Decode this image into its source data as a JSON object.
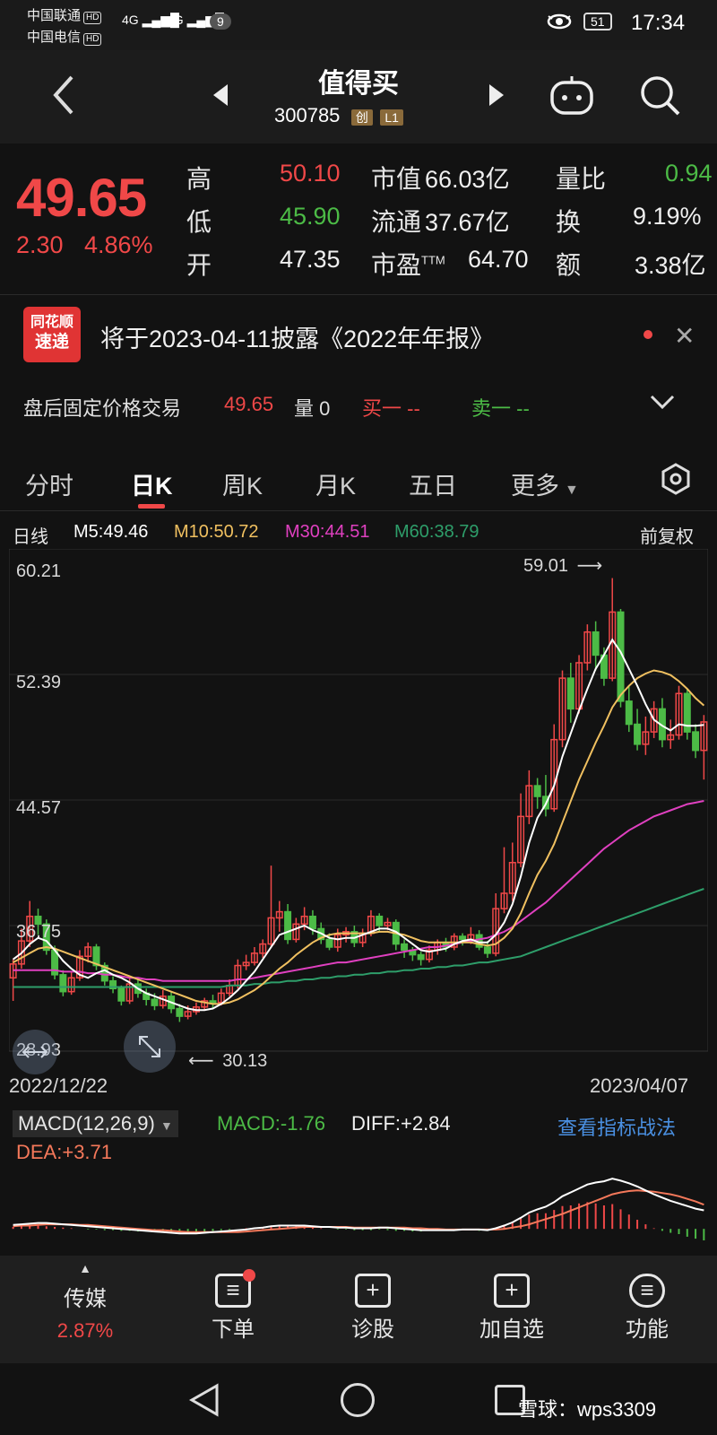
{
  "status_bar": {
    "carrier1": "中国联通",
    "carrier2": "中国电信",
    "hd": "HD",
    "network": "4G",
    "notif_count": "9",
    "battery": "51",
    "time": "17:34"
  },
  "header": {
    "title": "值得买",
    "code": "300785",
    "tag1": "创",
    "tag2": "L1"
  },
  "quote": {
    "price": "49.65",
    "change": "2.30",
    "change_pct": "4.86%",
    "high_label": "高",
    "high": "50.10",
    "low_label": "低",
    "low": "45.90",
    "open_label": "开",
    "open": "47.35",
    "mcap_label": "市值",
    "mcap": "66.03亿",
    "float_label": "流通",
    "float": "37.67亿",
    "pe_label": "市盈",
    "pe_sup": "TTM",
    "pe": "64.70",
    "vr_label": "量比",
    "vr": "0.94",
    "turnover_label": "换",
    "turnover": "9.19%",
    "amount_label": "额",
    "amount": "3.38亿"
  },
  "notice": {
    "logo_line1": "同花顺",
    "logo_line2": "速递",
    "text": "将于2023-04-11披露《2022年年报》"
  },
  "after_hours": {
    "label": "盘后固定价格交易",
    "price": "49.65",
    "vol_label": "量",
    "vol": "0",
    "buy": "买一 --",
    "sell": "卖一 --"
  },
  "tabs": [
    "分时",
    "日K",
    "周K",
    "月K",
    "五日",
    "更多"
  ],
  "kline": {
    "label": "日线",
    "ma5": "M5:49.46",
    "ma10": "M10:50.72",
    "ma30": "M30:44.51",
    "ma60": "M60:38.79",
    "adjust": "前复权",
    "y_ticks": [
      "60.21",
      "52.39",
      "44.57",
      "36.75",
      "28.93"
    ],
    "high_mark": "59.01",
    "low_mark": "30.13",
    "date_start": "2022/12/22",
    "date_end": "2023/04/07"
  },
  "macd": {
    "selector": "MACD(12,26,9)",
    "macd": "MACD:-1.76",
    "diff": "DIFF:+2.84",
    "dea": "DEA:+3.71",
    "link": "查看指标战法"
  },
  "bottom_nav": {
    "sector_name": "传媒",
    "sector_pct": "2.87%",
    "order": "下单",
    "diagnose": "诊股",
    "add_fav": "加自选",
    "functions": "功能"
  },
  "watermark": "雪球：wps3309",
  "colors": {
    "up": "#f04848",
    "down": "#4cbb46",
    "ma5": "#ffffff",
    "ma10": "#f0c060",
    "ma30": "#e040c0",
    "ma60": "#2e9e6a"
  },
  "chart_data": {
    "type": "candlestick",
    "x_range": [
      "2022/12/22",
      "2023/04/07"
    ],
    "ylim": [
      28.93,
      60.21
    ],
    "candles": [
      [
        33.0,
        33.9,
        31.5,
        34.2
      ],
      [
        33.9,
        35.4,
        33.6,
        36.2
      ],
      [
        35.4,
        37.0,
        35.0,
        38.0
      ],
      [
        37.0,
        36.5,
        35.8,
        37.5
      ],
      [
        36.5,
        34.8,
        34.5,
        36.8
      ],
      [
        34.8,
        33.2,
        32.9,
        35.1
      ],
      [
        33.2,
        32.1,
        31.8,
        33.5
      ],
      [
        32.1,
        33.0,
        31.9,
        33.4
      ],
      [
        33.0,
        34.4,
        32.8,
        34.8
      ],
      [
        34.4,
        35.0,
        34.0,
        35.3
      ],
      [
        35.0,
        33.8,
        33.5,
        35.2
      ],
      [
        33.8,
        32.8,
        32.5,
        34.0
      ],
      [
        32.8,
        32.3,
        32.0,
        33.1
      ],
      [
        32.3,
        31.5,
        31.2,
        32.5
      ],
      [
        31.5,
        32.6,
        31.3,
        33.0
      ],
      [
        32.6,
        32.0,
        31.7,
        32.9
      ],
      [
        32.0,
        31.6,
        31.2,
        32.3
      ],
      [
        31.6,
        31.2,
        30.9,
        32.0
      ],
      [
        31.2,
        31.8,
        31.0,
        32.2
      ],
      [
        31.8,
        31.0,
        30.7,
        32.1
      ],
      [
        31.0,
        30.5,
        30.13,
        31.3
      ],
      [
        30.5,
        30.8,
        30.3,
        31.2
      ],
      [
        30.8,
        31.1,
        30.6,
        31.4
      ],
      [
        31.1,
        31.5,
        30.9,
        31.7
      ],
      [
        31.5,
        31.4,
        31.0,
        31.9
      ],
      [
        31.4,
        32.0,
        31.2,
        32.3
      ],
      [
        32.0,
        32.5,
        31.8,
        32.9
      ],
      [
        32.5,
        33.8,
        32.3,
        34.2
      ],
      [
        33.8,
        34.0,
        33.5,
        34.5
      ],
      [
        34.0,
        34.6,
        33.8,
        35.0
      ],
      [
        34.6,
        35.2,
        34.3,
        35.5
      ],
      [
        35.2,
        36.9,
        35.0,
        40.3
      ],
      [
        36.9,
        37.3,
        36.0,
        38.0
      ],
      [
        37.3,
        35.5,
        35.2,
        37.8
      ],
      [
        35.5,
        36.5,
        35.3,
        36.9
      ],
      [
        36.5,
        37.0,
        36.1,
        37.6
      ],
      [
        37.0,
        36.2,
        35.8,
        37.4
      ],
      [
        36.2,
        35.5,
        35.2,
        36.6
      ],
      [
        35.5,
        35.0,
        34.8,
        35.9
      ],
      [
        35.0,
        35.8,
        34.7,
        36.2
      ],
      [
        35.8,
        36.0,
        35.3,
        36.3
      ],
      [
        36.0,
        35.3,
        35.0,
        36.4
      ],
      [
        35.3,
        35.9,
        35.0,
        36.2
      ],
      [
        35.9,
        37.0,
        35.7,
        37.4
      ],
      [
        37.0,
        36.4,
        36.0,
        37.2
      ],
      [
        36.4,
        36.6,
        36.1,
        36.9
      ],
      [
        36.6,
        35.2,
        34.8,
        36.8
      ],
      [
        35.2,
        34.8,
        34.3,
        35.5
      ],
      [
        34.8,
        34.5,
        34.1,
        35.0
      ],
      [
        34.5,
        34.2,
        33.8,
        34.7
      ],
      [
        34.2,
        34.8,
        34.0,
        35.1
      ],
      [
        34.8,
        35.3,
        34.5,
        35.5
      ],
      [
        35.3,
        35.0,
        34.7,
        35.6
      ],
      [
        35.0,
        35.7,
        34.8,
        35.9
      ],
      [
        35.7,
        35.5,
        35.1,
        35.9
      ],
      [
        35.5,
        35.8,
        35.2,
        36.3
      ],
      [
        35.8,
        35.0,
        34.8,
        36.1
      ],
      [
        35.0,
        34.6,
        34.3,
        35.4
      ],
      [
        34.6,
        37.5,
        34.4,
        38.5
      ],
      [
        37.5,
        38.5,
        37.2,
        41.5
      ],
      [
        38.5,
        40.5,
        38.0,
        41.8
      ],
      [
        40.5,
        43.5,
        40.2,
        45.0
      ],
      [
        43.5,
        45.5,
        43.0,
        46.5
      ],
      [
        45.5,
        44.8,
        44.0,
        46.0
      ],
      [
        44.8,
        44.0,
        43.5,
        46.2
      ],
      [
        44.0,
        48.5,
        43.8,
        49.5
      ],
      [
        48.5,
        52.5,
        48.0,
        53.0
      ],
      [
        52.5,
        50.5,
        49.6,
        53.5
      ],
      [
        50.5,
        53.5,
        50.2,
        54.0
      ],
      [
        53.5,
        55.5,
        53.0,
        56.0
      ],
      [
        55.5,
        54.0,
        53.0,
        56.2
      ],
      [
        54.0,
        52.5,
        52.0,
        54.5
      ],
      [
        52.5,
        56.8,
        52.3,
        59.01
      ],
      [
        56.8,
        51.0,
        50.6,
        57.0
      ],
      [
        51.0,
        49.5,
        49.0,
        52.0
      ],
      [
        49.5,
        48.2,
        47.8,
        50.5
      ],
      [
        48.2,
        49.0,
        47.5,
        50.0
      ],
      [
        49.0,
        50.5,
        48.6,
        51.0
      ],
      [
        50.5,
        48.5,
        48.0,
        51.2
      ],
      [
        48.5,
        48.8,
        47.9,
        49.8
      ],
      [
        48.8,
        51.5,
        48.5,
        52.0
      ],
      [
        51.5,
        49.0,
        48.5,
        51.8
      ],
      [
        49.0,
        47.8,
        47.3,
        49.5
      ],
      [
        47.8,
        49.65,
        45.9,
        50.1
      ]
    ],
    "ma5": [
      34.2,
      34.6,
      35.2,
      35.6,
      35.4,
      34.8,
      34.1,
      33.6,
      33.2,
      33.0,
      33.3,
      33.5,
      33.2,
      33.0,
      32.7,
      32.3,
      32.0,
      31.8,
      31.6,
      31.4,
      31.2,
      31.0,
      30.9,
      30.9,
      31.0,
      31.3,
      31.7,
      32.2,
      32.8,
      33.4,
      34.2,
      35.0,
      35.8,
      36.0,
      36.2,
      36.4,
      36.1,
      35.9,
      35.6,
      35.5,
      35.6,
      35.6,
      35.8,
      36.0,
      36.2,
      36.2,
      36.0,
      35.6,
      35.2,
      34.8,
      34.7,
      34.8,
      34.9,
      35.2,
      35.4,
      35.5,
      35.3,
      35.3,
      35.8,
      36.6,
      37.8,
      39.6,
      41.8,
      43.4,
      44.3,
      45.5,
      47.4,
      48.9,
      50.4,
      51.8,
      53.1,
      54.0,
      55.0,
      54.2,
      53.1,
      52.0,
      50.8,
      49.8,
      49.4,
      49.1,
      49.5,
      49.4,
      49.4,
      49.46
    ],
    "ma10": [
      34.0,
      34.3,
      34.6,
      34.9,
      35.0,
      34.9,
      34.7,
      34.5,
      34.3,
      34.1,
      33.9,
      33.7,
      33.5,
      33.3,
      33.1,
      32.9,
      32.7,
      32.5,
      32.3,
      32.1,
      31.9,
      31.7,
      31.5,
      31.4,
      31.3,
      31.3,
      31.4,
      31.6,
      31.9,
      32.2,
      32.6,
      33.1,
      33.6,
      34.0,
      34.5,
      34.9,
      35.3,
      35.6,
      35.8,
      35.9,
      35.9,
      35.9,
      35.9,
      35.9,
      36.0,
      36.0,
      35.9,
      35.8,
      35.6,
      35.4,
      35.3,
      35.3,
      35.3,
      35.3,
      35.3,
      35.3,
      35.2,
      35.1,
      35.2,
      35.6,
      36.2,
      37.2,
      38.5,
      39.7,
      40.6,
      41.7,
      43.1,
      44.5,
      45.9,
      47.1,
      48.3,
      49.4,
      50.6,
      51.4,
      52.0,
      52.5,
      52.8,
      53.0,
      52.9,
      52.7,
      52.3,
      51.8,
      51.2,
      50.72
    ],
    "ma30": [
      33.5,
      33.5,
      33.5,
      33.5,
      33.5,
      33.5,
      33.4,
      33.4,
      33.4,
      33.3,
      33.3,
      33.2,
      33.2,
      33.1,
      33.0,
      33.0,
      32.9,
      32.9,
      32.8,
      32.8,
      32.8,
      32.8,
      32.8,
      32.8,
      32.8,
      32.8,
      32.8,
      32.9,
      32.9,
      33.0,
      33.1,
      33.2,
      33.3,
      33.4,
      33.5,
      33.6,
      33.7,
      33.8,
      33.9,
      34.0,
      34.0,
      34.1,
      34.2,
      34.3,
      34.4,
      34.5,
      34.6,
      34.7,
      34.8,
      34.9,
      35.0,
      35.0,
      35.1,
      35.2,
      35.3,
      35.4,
      35.5,
      35.6,
      35.8,
      36.0,
      36.3,
      36.7,
      37.1,
      37.5,
      37.9,
      38.4,
      38.9,
      39.4,
      39.9,
      40.4,
      40.9,
      41.4,
      41.8,
      42.2,
      42.6,
      42.9,
      43.2,
      43.5,
      43.7,
      43.9,
      44.1,
      44.3,
      44.4,
      44.51
    ],
    "ma60": [
      32.4,
      32.4,
      32.4,
      32.4,
      32.4,
      32.4,
      32.4,
      32.4,
      32.4,
      32.4,
      32.4,
      32.4,
      32.4,
      32.4,
      32.4,
      32.4,
      32.4,
      32.4,
      32.4,
      32.4,
      32.4,
      32.4,
      32.4,
      32.4,
      32.4,
      32.4,
      32.5,
      32.5,
      32.5,
      32.6,
      32.6,
      32.7,
      32.7,
      32.8,
      32.8,
      32.9,
      32.9,
      33.0,
      33.0,
      33.1,
      33.1,
      33.2,
      33.2,
      33.3,
      33.3,
      33.4,
      33.4,
      33.5,
      33.5,
      33.6,
      33.6,
      33.7,
      33.7,
      33.8,
      33.8,
      33.9,
      34.0,
      34.0,
      34.1,
      34.2,
      34.3,
      34.4,
      34.6,
      34.8,
      35.0,
      35.2,
      35.4,
      35.6,
      35.8,
      36.0,
      36.2,
      36.4,
      36.6,
      36.8,
      37.0,
      37.2,
      37.4,
      37.6,
      37.8,
      38.0,
      38.2,
      38.4,
      38.6,
      38.79
    ],
    "macd_hist": [
      0.3,
      0.4,
      0.5,
      0.5,
      0.4,
      0.3,
      0.2,
      0.1,
      0.0,
      -0.1,
      -0.1,
      -0.2,
      -0.2,
      -0.3,
      -0.3,
      -0.4,
      -0.4,
      -0.5,
      -0.5,
      -0.6,
      -0.6,
      -0.5,
      -0.5,
      -0.4,
      -0.3,
      -0.2,
      -0.1,
      0.0,
      0.1,
      0.2,
      0.3,
      0.5,
      0.6,
      0.5,
      0.4,
      0.3,
      0.2,
      0.1,
      0.0,
      -0.1,
      -0.1,
      -0.2,
      -0.2,
      -0.2,
      -0.1,
      -0.2,
      -0.3,
      -0.3,
      -0.4,
      -0.4,
      -0.3,
      -0.3,
      -0.3,
      -0.2,
      -0.2,
      -0.2,
      -0.3,
      -0.3,
      0.2,
      0.6,
      1.0,
      1.6,
      2.2,
      2.4,
      2.4,
      2.9,
      3.5,
      3.6,
      3.9,
      4.1,
      3.9,
      3.6,
      3.8,
      3.0,
      2.2,
      1.4,
      0.7,
      0.1,
      -0.3,
      -0.6,
      -0.8,
      -1.2,
      -1.5,
      -1.76
    ],
    "diff": [
      0.6,
      0.7,
      0.8,
      0.9,
      0.9,
      0.8,
      0.7,
      0.6,
      0.5,
      0.4,
      0.3,
      0.2,
      0.1,
      0.0,
      -0.1,
      -0.2,
      -0.3,
      -0.4,
      -0.5,
      -0.6,
      -0.7,
      -0.7,
      -0.7,
      -0.6,
      -0.5,
      -0.4,
      -0.3,
      -0.2,
      -0.1,
      0.1,
      0.2,
      0.4,
      0.5,
      0.5,
      0.5,
      0.5,
      0.4,
      0.3,
      0.3,
      0.2,
      0.2,
      0.1,
      0.1,
      0.1,
      0.2,
      0.2,
      0.1,
      0.0,
      -0.1,
      -0.2,
      -0.2,
      -0.2,
      -0.2,
      -0.2,
      -0.1,
      -0.1,
      -0.1,
      -0.2,
      0.1,
      0.5,
      1.0,
      1.7,
      2.5,
      3.0,
      3.4,
      4.1,
      5.0,
      5.6,
      6.2,
      6.8,
      7.1,
      7.3,
      7.7,
      7.4,
      7.0,
      6.5,
      5.9,
      5.3,
      4.8,
      4.3,
      3.9,
      3.5,
      3.1,
      2.84
    ],
    "dea": [
      0.4,
      0.5,
      0.5,
      0.6,
      0.7,
      0.7,
      0.7,
      0.7,
      0.6,
      0.6,
      0.5,
      0.4,
      0.3,
      0.2,
      0.1,
      0.0,
      -0.1,
      -0.2,
      -0.2,
      -0.3,
      -0.4,
      -0.5,
      -0.5,
      -0.5,
      -0.5,
      -0.5,
      -0.5,
      -0.5,
      -0.4,
      -0.3,
      -0.2,
      -0.1,
      0.0,
      0.1,
      0.2,
      0.3,
      0.3,
      0.3,
      0.3,
      0.3,
      0.3,
      0.2,
      0.2,
      0.2,
      0.2,
      0.2,
      0.2,
      0.2,
      0.1,
      0.1,
      0.0,
      0.0,
      -0.1,
      -0.1,
      -0.1,
      -0.1,
      -0.1,
      -0.1,
      -0.1,
      0.0,
      0.2,
      0.4,
      0.7,
      1.1,
      1.5,
      1.9,
      2.3,
      2.8,
      3.3,
      3.8,
      4.3,
      4.8,
      5.3,
      5.6,
      5.8,
      5.9,
      5.8,
      5.7,
      5.5,
      5.3,
      5.0,
      4.6,
      4.2,
      3.71
    ]
  }
}
